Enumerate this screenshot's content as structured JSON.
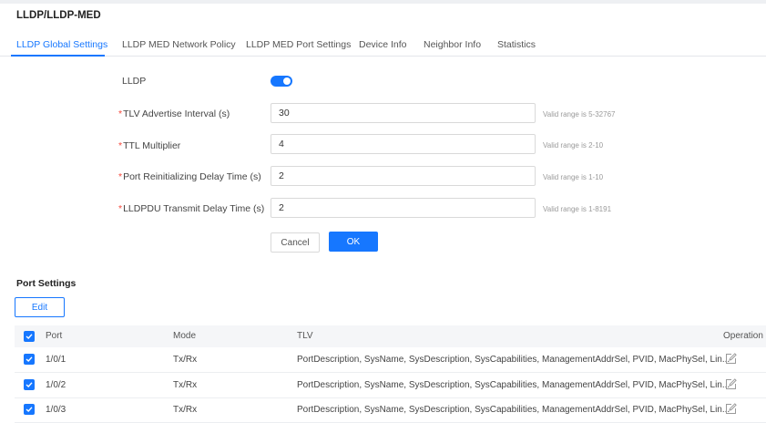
{
  "page_title": "LLDP/LLDP-MED",
  "tabs": [
    {
      "label": "LLDP Global Settings"
    },
    {
      "label": "LLDP MED Network Policy"
    },
    {
      "label": "LLDP MED Port Settings"
    },
    {
      "label": "Device Info"
    },
    {
      "label": "Neighbor Info"
    },
    {
      "label": "Statistics"
    }
  ],
  "form": {
    "lldp_label": "LLDP",
    "lldp_enabled": true,
    "fields": [
      {
        "label": "TLV Advertise Interval (s)",
        "value": "30",
        "hint": "Valid range is 5-32767"
      },
      {
        "label": "TTL Multiplier",
        "value": "4",
        "hint": "Valid range is 2-10"
      },
      {
        "label": "Port Reinitializing Delay Time (s)",
        "value": "2",
        "hint": "Valid range is 1-10"
      },
      {
        "label": "LLDPDU Transmit Delay Time (s)",
        "value": "2",
        "hint": "Valid range is 1-8191"
      }
    ],
    "required_mark": "*",
    "cancel_label": "Cancel",
    "ok_label": "OK"
  },
  "port_settings": {
    "title": "Port Settings",
    "edit_label": "Edit",
    "columns": [
      "Port",
      "Mode",
      "TLV",
      "Operation"
    ],
    "rows": [
      {
        "port": "1/0/1",
        "mode": "Tx/Rx",
        "tlv": "PortDescription, SysName, SysDescription, SysCapabilities, ManagementAddrSel, PVID, MacPhySel, Lin..."
      },
      {
        "port": "1/0/2",
        "mode": "Tx/Rx",
        "tlv": "PortDescription, SysName, SysDescription, SysCapabilities, ManagementAddrSel, PVID, MacPhySel, Lin..."
      },
      {
        "port": "1/0/3",
        "mode": "Tx/Rx",
        "tlv": "PortDescription, SysName, SysDescription, SysCapabilities, ManagementAddrSel, PVID, MacPhySel, Lin..."
      }
    ]
  },
  "colors": {
    "accent": "#1677ff",
    "required": "#f5483b"
  }
}
